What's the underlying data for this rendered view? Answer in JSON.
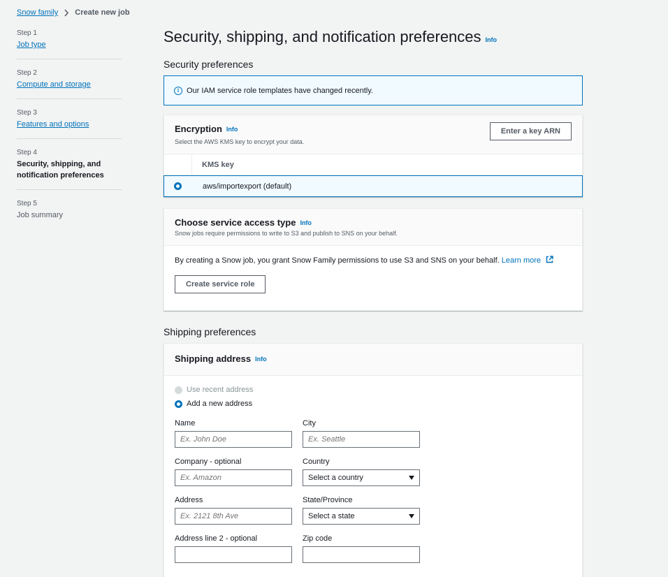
{
  "breadcrumb": {
    "root": "Snow family",
    "current": "Create new job"
  },
  "steps": [
    {
      "num": "Step 1",
      "title": "Job type"
    },
    {
      "num": "Step 2",
      "title": "Compute and storage"
    },
    {
      "num": "Step 3",
      "title": "Features and options"
    },
    {
      "num": "Step 4",
      "title": "Security, shipping, and notification preferences"
    },
    {
      "num": "Step 5",
      "title": "Job summary"
    }
  ],
  "page": {
    "title": "Security, shipping, and notification preferences",
    "info": "Info"
  },
  "security": {
    "heading": "Security preferences",
    "alert": "Our IAM service role templates have changed recently.",
    "encryption": {
      "title": "Encryption",
      "info": "Info",
      "description": "Select the AWS KMS key to encrypt your data.",
      "button": "Enter a key ARN",
      "column": "KMS key",
      "selected_key": "aws/importexport (default)"
    },
    "access": {
      "title": "Choose service access type",
      "info": "Info",
      "description": "Snow jobs require permissions to write to S3 and publish to SNS on your behalf.",
      "body": "By creating a Snow job, you grant Snow Family permissions to use S3 and SNS on your behalf.",
      "learn_more": "Learn more",
      "button": "Create service role"
    }
  },
  "shipping": {
    "heading": "Shipping preferences",
    "title": "Shipping address",
    "info": "Info",
    "option_recent": "Use recent address",
    "option_new": "Add a new address",
    "fields": {
      "name": {
        "label": "Name",
        "placeholder": "Ex. John Doe"
      },
      "city": {
        "label": "City",
        "placeholder": "Ex. Seattle"
      },
      "company": {
        "label": "Company - optional",
        "placeholder": "Ex. Amazon"
      },
      "country": {
        "label": "Country",
        "value": "Select a country"
      },
      "address": {
        "label": "Address",
        "placeholder": "Ex. 2121 8th Ave"
      },
      "state": {
        "label": "State/Province",
        "value": "Select a state"
      },
      "address2": {
        "label": "Address line 2 - optional"
      },
      "zip": {
        "label": "Zip code"
      }
    }
  }
}
